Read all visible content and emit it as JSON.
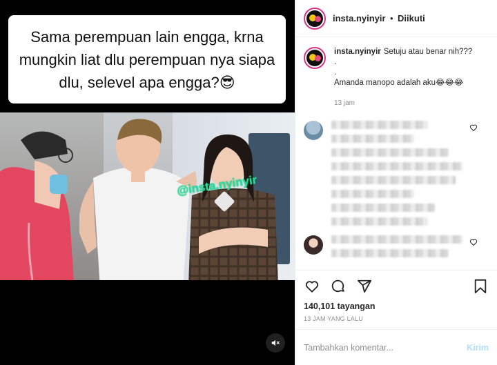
{
  "media": {
    "caption": "Sama perempuan lain engga, krna mungkin liat dlu perempuan nya siapa dlu, selevel apa engga?😎",
    "watermark": "@insta.nyinyir",
    "mute_icon": "speaker-muted-icon"
  },
  "header": {
    "username": "insta.nyinyir",
    "separator": "•",
    "follow_state": "Diikuti"
  },
  "post": {
    "username": "insta.nyinyir",
    "caption_lines": [
      "Setuju atau benar nih???",
      ".",
      ".",
      "Amanda manopo adalah aku😂😂😂"
    ],
    "time": "13 jam"
  },
  "actions": {
    "like_icon": "heart-icon",
    "comment_icon": "comment-icon",
    "share_icon": "share-icon",
    "save_icon": "bookmark-icon"
  },
  "stats": {
    "views": "140,101 tayangan",
    "posted_ago": "13 JAM YANG LALU"
  },
  "comment_box": {
    "placeholder": "Tambahkan komentar...",
    "post_label": "Kirim"
  },
  "colors": {
    "accent_disabled": "#b2dffc",
    "story_ring": "#d63384",
    "watermark": "#2cd8a8"
  }
}
